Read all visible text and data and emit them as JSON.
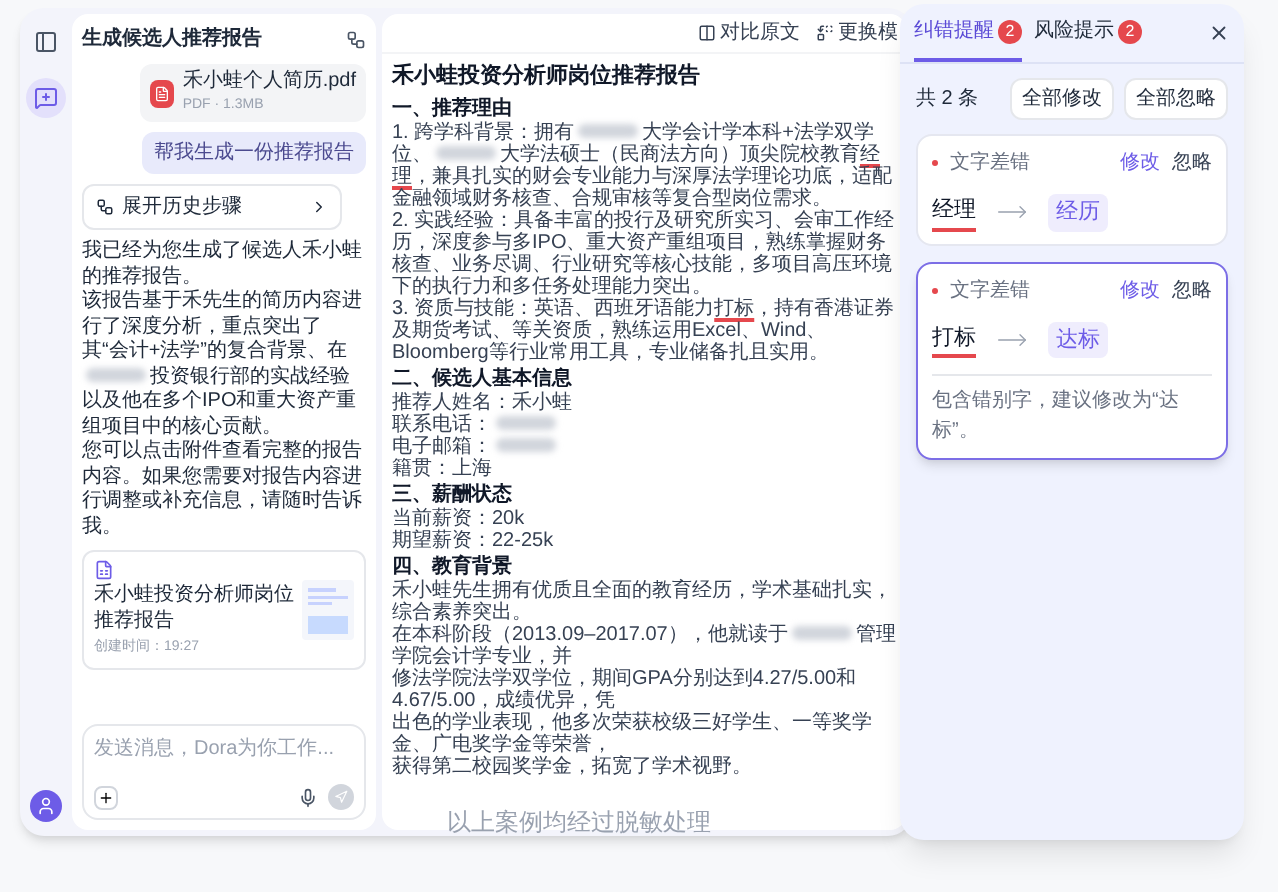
{
  "sidebar": {
    "items": [
      {
        "kind": "panel",
        "selected": false
      },
      {
        "kind": "new-chat",
        "selected": true
      }
    ]
  },
  "chat": {
    "title": "生成候选人推荐报告",
    "attachment": {
      "name": "禾小蛙个人简历.pdf",
      "meta": "PDF · 1.3MB"
    },
    "user_message": "帮我生成一份推荐报告",
    "history_button": "展开历史步骤",
    "reply": [
      "我已经为您生成了候选人禾小蛙的推荐报告。",
      {
        "parts": [
          {
            "kind": "text",
            "text": "该报告基于禾先生的简历内容进行了深度分析，重点突出了其“会计+法学”的复合背景、在"
          },
          {
            "kind": "redacted"
          },
          {
            "kind": "text",
            "text": "投资银行部的实战经验以及他在多个IPO和重大资产重组项目中的核心贡献。"
          }
        ]
      },
      "您可以点击附件查看完整的报告内容。如果您需要对报告内容进行调整或补充信息，请随时告诉我。"
    ],
    "report_card": {
      "title": "禾小蛙投资分析师岗位推荐报告",
      "time": "创建时间：19:27"
    },
    "input": {
      "placeholder": "发送消息，Dora为你工作..."
    }
  },
  "document": {
    "toolbar": [
      {
        "kind": "compare",
        "label": "对比原文"
      },
      {
        "kind": "swap",
        "label": "更换模"
      }
    ],
    "title": "禾小蛙投资分析师岗位推荐报告",
    "sections": [
      {
        "heading": "一、推荐理由",
        "paragraphs": [
          {
            "parts": [
              {
                "kind": "text",
                "text": "1. 跨学科背景：拥有"
              },
              {
                "kind": "redacted"
              },
              {
                "kind": "text",
                "text": "大学会计学本科+法学双学位、"
              },
              {
                "kind": "redacted"
              },
              {
                "kind": "text",
                "text": "大学法硕士（民商法方向）顶尖院校教育"
              },
              {
                "kind": "flagged",
                "text": "经理"
              },
              {
                "kind": "text",
                "text": "，兼具扎实的财会专业能力与深厚法学理论功底，适配金融领域财务核查、合规审核等复合型岗位需求。"
              }
            ]
          },
          {
            "parts": [
              {
                "kind": "text",
                "text": "2. 实践经验：具备丰富的投行及研究所实习、会审工作经历，深度参与多IPO、重大资产重组项目，熟练掌握财务核查、业务尽调、行业研究等核心技能，多项目高压环境下的执行力和多任务处理能力突出。"
              }
            ]
          },
          {
            "parts": [
              {
                "kind": "text",
                "text": "3. 资质与技能：英语、西班牙语能力"
              },
              {
                "kind": "flagged",
                "text": "打标"
              },
              {
                "kind": "text",
                "text": "，持有香港证券及期货考试、等关资质，熟练运用Excel、Wind、Bloomberg等行业常用工具，专业储备扎且实用。"
              }
            ]
          }
        ]
      },
      {
        "heading": "二、候选人基本信息",
        "paragraphs": [
          {
            "parts": [
              {
                "kind": "text",
                "text": "推荐人姓名：禾小蛙"
              }
            ]
          },
          {
            "parts": [
              {
                "kind": "text",
                "text": "联系电话："
              },
              {
                "kind": "redacted"
              }
            ]
          },
          {
            "parts": [
              {
                "kind": "text",
                "text": "电子邮箱："
              },
              {
                "kind": "redacted"
              }
            ]
          },
          {
            "parts": [
              {
                "kind": "text",
                "text": "籍贯：上海"
              }
            ]
          }
        ]
      },
      {
        "heading": "三、薪酬状态",
        "paragraphs": [
          {
            "parts": [
              {
                "kind": "text",
                "text": "当前薪资：20k"
              }
            ]
          },
          {
            "parts": [
              {
                "kind": "text",
                "text": "期望薪资：22-25k"
              }
            ]
          }
        ]
      },
      {
        "heading": "四、教育背景",
        "paragraphs": [
          {
            "parts": [
              {
                "kind": "text",
                "text": "禾小蛙先生拥有优质且全面的教育经历，学术基础扎实，综合素养突出。"
              }
            ]
          },
          {
            "parts": [
              {
                "kind": "text",
                "text": "在本科阶段（2013.09–2017.07），他就读于"
              },
              {
                "kind": "redacted"
              },
              {
                "kind": "text",
                "text": "管理学院会计学专业，并"
              }
            ]
          },
          {
            "parts": [
              {
                "kind": "text",
                "text": "修法学院法学双学位，期间GPA分别达到4.27/5.00和4.67/5.00，成绩优异，凭"
              }
            ]
          },
          {
            "parts": [
              {
                "kind": "text",
                "text": "出色的学业表现，他多次荣获校级三好学生、一等奖学金、广电奖学金等荣誉，"
              }
            ]
          },
          {
            "parts": [
              {
                "kind": "text",
                "text": "获得第二校园奖学金，拓宽了学术视野。"
              }
            ]
          }
        ]
      }
    ]
  },
  "errors_panel": {
    "tabs": [
      {
        "label": "纠错提醒",
        "count": "2",
        "selected": true
      },
      {
        "label": "风险提示",
        "count": "2",
        "selected": false
      }
    ],
    "total": "共 2 条",
    "actions": [
      "全部修改",
      "全部忽略"
    ],
    "items": [
      {
        "category": "文字差错",
        "fix": "修改",
        "ignore": "忽略",
        "original": "经理",
        "suggestion": "经历",
        "selected": false
      },
      {
        "category": "文字差错",
        "fix": "修改",
        "ignore": "忽略",
        "original": "打标",
        "suggestion": "达标",
        "selected": true,
        "note": "包含错别字，建议修改为“达标”。"
      }
    ]
  },
  "caption": "以上案例均经过脱敏处理"
}
